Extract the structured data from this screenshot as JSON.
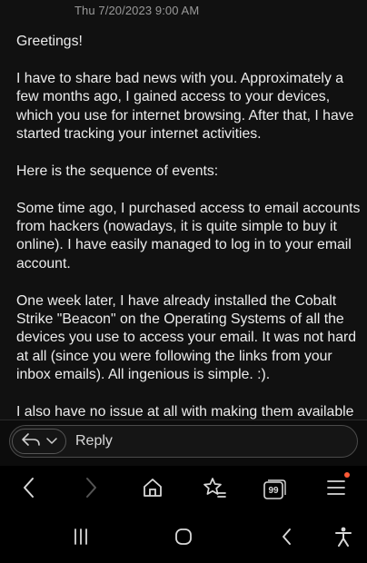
{
  "email": {
    "timestamp": "Thu 7/20/2023 9:00 AM",
    "paragraphs": [
      "Greetings!",
      "I have to share bad news with you. Approximately a few months ago, I gained access to your devices, which you use for internet browsing. After that, I have started tracking your internet activities.",
      "Here is the sequence of events:",
      "Some time ago, I purchased access to email accounts from hackers (nowadays, it is quite simple to buy it online). I have easily managed to log in to your email account.",
      "One week later, I have already installed the Cobalt Strike \"Beacon\" on the Operating Systems of all the devices you use to access your email. It was not hard at all (since you were following the links from your inbox emails). All ingenious is simple. :).",
      "I also have no issue at all with making them available for public access (leaked and exposed all data)."
    ]
  },
  "reply_bar": {
    "reply_label": "Reply",
    "reply_icon": "reply-arrow-icon",
    "options_icon": "chevron-down-icon"
  },
  "browser_nav": {
    "tab_count": "99",
    "notification_color": "#ff5a36",
    "icons": [
      "back-arrow-icon",
      "forward-arrow-icon",
      "home-icon",
      "bookmark-star-icon",
      "tabs-icon",
      "menu-icon"
    ]
  },
  "system_nav": {
    "icons": [
      "recent-apps-icon",
      "home-button-icon",
      "back-button-icon",
      "accessibility-icon"
    ]
  },
  "colors": {
    "background": "#111111",
    "text": "#ececec",
    "muted": "#9a9a9a"
  }
}
